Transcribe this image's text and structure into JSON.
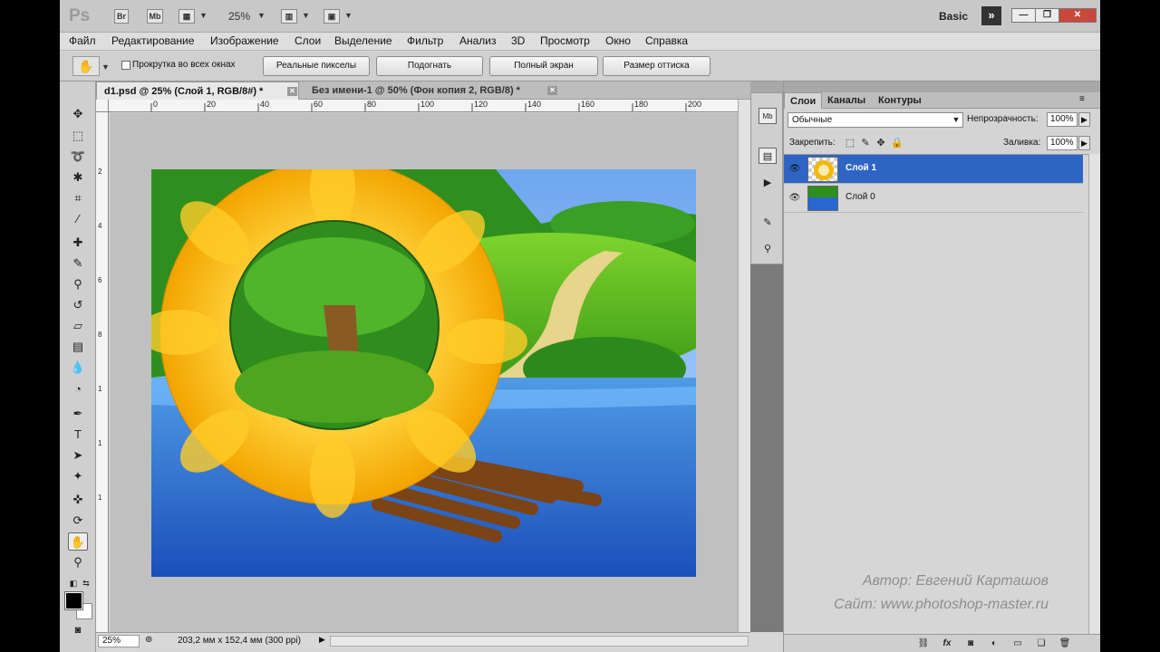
{
  "app": {
    "logo": "Ps",
    "bridge": "Br",
    "minibridge": "Mb",
    "zoom": "25%",
    "workspace": "Basic"
  },
  "menu": [
    "Файл",
    "Редактирование",
    "Изображение",
    "Слои",
    "Выделение",
    "Фильтр",
    "Анализ",
    "3D",
    "Просмотр",
    "Окно",
    "Справка"
  ],
  "options": {
    "scroll_all": "Прокрутка во всех окнах",
    "buttons": [
      "Реальные пикселы",
      "Подогнать",
      "Полный экран",
      "Размер оттиска"
    ]
  },
  "doc_tabs": [
    {
      "label": "d1.psd @ 25% (Слой 1, RGB/8#) *"
    },
    {
      "label": "Без имени-1 @ 50% (Фон копия 2, RGB/8) *"
    }
  ],
  "ruler": {
    "h": [
      "0",
      "20",
      "40",
      "60",
      "80",
      "100",
      "120",
      "140",
      "160",
      "180",
      "200"
    ],
    "v": [
      "2",
      "4",
      "6",
      "8",
      "1",
      "1",
      "1"
    ]
  },
  "status": {
    "zoom": "25%",
    "info": "203,2 мм x 152,4 мм (300 ppi)"
  },
  "layers_panel": {
    "tabs": [
      "Слои",
      "Каналы",
      "Контуры"
    ],
    "blend_mode": "Обычные",
    "opacity_label": "Непрозрачность:",
    "opacity": "100%",
    "lock_label": "Закрепить:",
    "fill_label": "Заливка:",
    "fill": "100%",
    "layers": [
      {
        "name": "Слой 1",
        "selected": true
      },
      {
        "name": "Слой 0",
        "selected": false
      }
    ]
  },
  "watermark": {
    "author": "Автор: Евгений Карташов",
    "site": "Сайт: www.photoshop-master.ru"
  },
  "colors": {
    "selection": "#2e65c4",
    "close_button": "#c9473c"
  }
}
